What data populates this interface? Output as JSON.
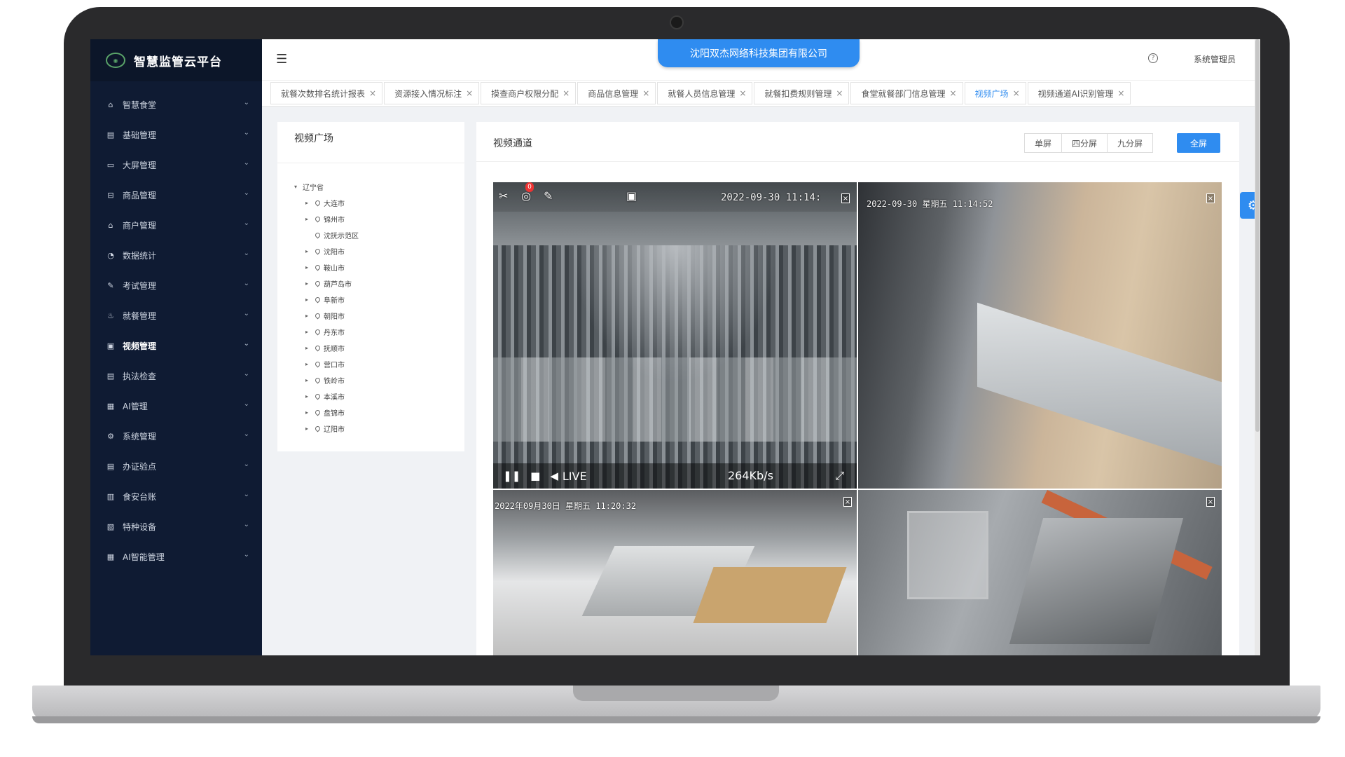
{
  "app": {
    "logo_text": "智慧监管云平台",
    "company": "沈阳双杰网络科技集团有限公司",
    "user": "系统管理员"
  },
  "colors": {
    "sidebar_bg": "#0f1b33",
    "accent": "#2f8cf0"
  },
  "sidebar": {
    "items": [
      {
        "label": "智慧食堂",
        "icon": "home-icon"
      },
      {
        "label": "基础管理",
        "icon": "list-icon"
      },
      {
        "label": "大屏管理",
        "icon": "monitor-icon"
      },
      {
        "label": "商品管理",
        "icon": "gift-icon"
      },
      {
        "label": "商户管理",
        "icon": "bank-icon"
      },
      {
        "label": "数据统计",
        "icon": "pie-chart-icon"
      },
      {
        "label": "考试管理",
        "icon": "pen-icon"
      },
      {
        "label": "就餐管理",
        "icon": "cup-icon"
      },
      {
        "label": "视频管理",
        "icon": "video-icon",
        "active": true
      },
      {
        "label": "执法检查",
        "icon": "doc-icon"
      },
      {
        "label": "AI管理",
        "icon": "ai-icon"
      },
      {
        "label": "系统管理",
        "icon": "gear-icon"
      },
      {
        "label": "办证验点",
        "icon": "doc-icon"
      },
      {
        "label": "食安台账",
        "icon": "book-icon"
      },
      {
        "label": "特种设备",
        "icon": "device-icon"
      },
      {
        "label": "AI智能管理",
        "icon": "ai-icon"
      }
    ]
  },
  "tabs": [
    {
      "label": "就餐次数排名统计报表"
    },
    {
      "label": "资源接入情况标注"
    },
    {
      "label": "摸查商户权限分配"
    },
    {
      "label": "商品信息管理"
    },
    {
      "label": "就餐人员信息管理"
    },
    {
      "label": "就餐扣费规则管理"
    },
    {
      "label": "食堂就餐部门信息管理"
    },
    {
      "label": "视频广场",
      "active": true
    },
    {
      "label": "视频通道AI识别管理"
    }
  ],
  "tree_panel": {
    "title": "视频广场",
    "root": "辽宁省",
    "children": [
      {
        "label": "大连市",
        "expandable": true
      },
      {
        "label": "锦州市",
        "expandable": true
      },
      {
        "label": "沈抚示范区",
        "expandable": false
      },
      {
        "label": "沈阳市",
        "expandable": true
      },
      {
        "label": "鞍山市",
        "expandable": true
      },
      {
        "label": "葫芦岛市",
        "expandable": true
      },
      {
        "label": "阜新市",
        "expandable": true
      },
      {
        "label": "朝阳市",
        "expandable": true
      },
      {
        "label": "丹东市",
        "expandable": true
      },
      {
        "label": "抚顺市",
        "expandable": true
      },
      {
        "label": "营口市",
        "expandable": true
      },
      {
        "label": "铁岭市",
        "expandable": true
      },
      {
        "label": "本溪市",
        "expandable": true
      },
      {
        "label": "盘锦市",
        "expandable": true
      },
      {
        "label": "辽阳市",
        "expandable": true
      }
    ]
  },
  "video_panel": {
    "title": "视频通道",
    "layouts": [
      "单屏",
      "四分屏",
      "九分屏"
    ],
    "fullscreen": "全屏",
    "feeds": [
      {
        "timestamp": "2022-09-30 11:14:",
        "badge": "0",
        "live": "LIVE",
        "bitrate": "264Kb/s"
      },
      {
        "timestamp": "2022-09-30 星期五 11:14:52"
      },
      {
        "timestamp": "2022年09月30日 星期五 11:20:32"
      },
      {
        "timestamp": ""
      }
    ]
  }
}
